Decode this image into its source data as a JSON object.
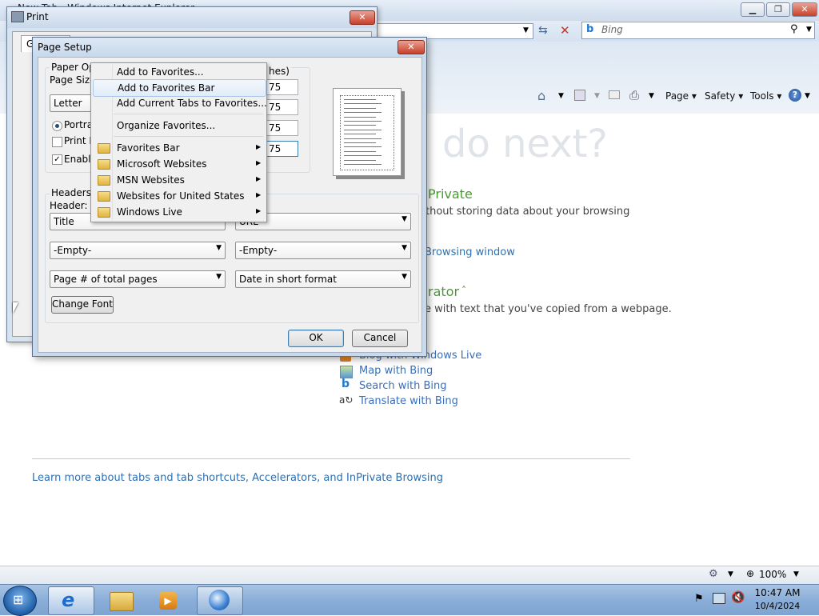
{
  "ie": {
    "window_title": "New Tab - Windows Internet Explorer",
    "search_placeholder": "Bing",
    "command_bar": {
      "page": "Page",
      "safety": "Safety",
      "tools": "Tools"
    },
    "content": {
      "heading": "do next?",
      "inprivate_title": "Private",
      "inprivate_desc": "thout storing data about your browsing",
      "inprivate_link": "Browsing window",
      "accelerator_title": "rator",
      "accelerator_desc": "e with text that you've copied from a webpage.",
      "accelerators": [
        "Blog with Windows Live",
        "Map with Bing",
        "Search with Bing",
        "Translate with Bing"
      ],
      "learn_more": "Learn more about tabs and tab shortcuts, Accelerators, and InPrivate Browsing"
    },
    "status": {
      "zoom": "100%"
    }
  },
  "print_dialog": {
    "title": "Print",
    "tab_label": "Ger"
  },
  "page_setup": {
    "title": "Page Setup",
    "paper_options_label": "Paper Opti",
    "page_size_label": "Page Size:",
    "page_size_value": "Letter",
    "portrait_label": "Portrait",
    "print_background_label": "Print Ba",
    "enable_shrink_label": "Enable",
    "margins_label": "hes)",
    "margins": [
      "75",
      "75",
      "75",
      "75"
    ],
    "headers_footers_label": "Headers ar",
    "header_label": "Header:",
    "header_left": "Title",
    "header_right": "URL",
    "mid_left": "-Empty-",
    "mid_right": "-Empty-",
    "footer_left": "Page # of total pages",
    "footer_right": "Date in short format",
    "change_font": "Change Font",
    "ok": "OK",
    "cancel": "Cancel"
  },
  "context_menu": {
    "items": [
      {
        "label": "Add to Favorites...",
        "submenu": false
      },
      {
        "label": "Add to Favorites Bar",
        "submenu": false
      },
      {
        "label": "Add Current Tabs to Favorites...",
        "submenu": false
      },
      {
        "label": "Organize Favorites...",
        "submenu": false
      },
      {
        "label": "Favorites Bar",
        "submenu": true
      },
      {
        "label": "Microsoft Websites",
        "submenu": true
      },
      {
        "label": "MSN Websites",
        "submenu": true
      },
      {
        "label": "Websites for United States",
        "submenu": true
      },
      {
        "label": "Windows Live",
        "submenu": true
      }
    ]
  },
  "taskbar": {
    "time": "10:47 AM",
    "date": "10/4/2024"
  },
  "colors": {
    "link": "#2e6fb0",
    "green_heading": "#4a9a32",
    "taskbar": "#8aaed8"
  }
}
